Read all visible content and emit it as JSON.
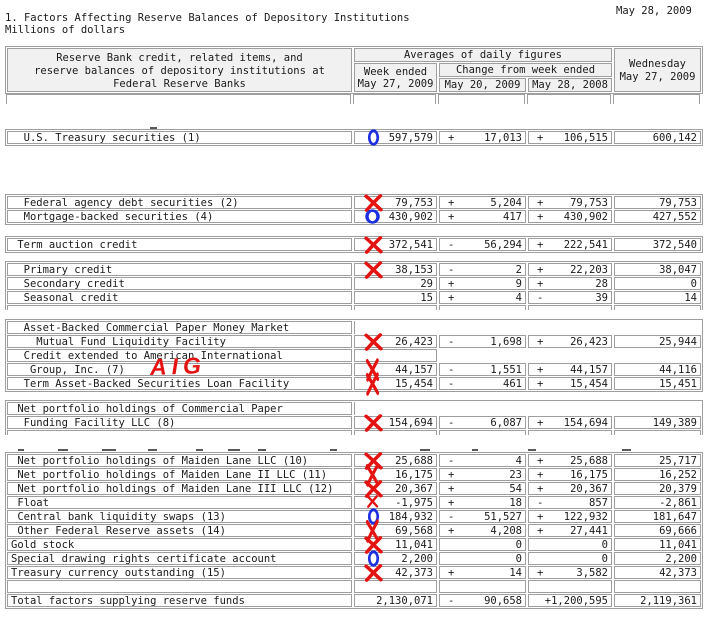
{
  "page": {
    "release_date": "May 28, 2009",
    "title": "1. Factors Affecting Reserve Balances of Depository Institutions",
    "subtitle": "Millions of dollars"
  },
  "colors": {
    "annotation_red": "#e51212",
    "annotation_blue": "#1b2ee0",
    "border_gray": "#9e9e9e"
  },
  "annotations": {
    "aig": "AIG"
  },
  "table": {
    "header": {
      "label_lines": [
        "Reserve Bank credit, related items, and",
        "reserve balances of depository institutions at",
        "Federal Reserve Banks"
      ],
      "averages": "Averages of daily figures",
      "week_ended_lines": [
        "Week ended",
        "May 27, 2009"
      ],
      "change_from": "Change from week ended",
      "change_col1": "May 20, 2009",
      "change_col2": "May 28, 2008",
      "wednesday_lines": [
        "Wednesday",
        "May 27, 2009"
      ]
    },
    "groups": [
      [
        {
          "t": "data",
          "label": "  U.S. Treasury securities (1)",
          "mark": "o",
          "week": "597,579",
          "c1s": "+",
          "c1v": "17,013",
          "c2s": "+",
          "c2v": "106,515",
          "wed": "600,142"
        }
      ],
      [
        {
          "t": "data",
          "label": "  Federal agency debt securities (2)",
          "mark": "x",
          "week": "79,753",
          "c1s": "+",
          "c1v": "5,204",
          "c2s": "+",
          "c2v": "79,753",
          "wed": "79,753"
        },
        {
          "t": "data",
          "label": "  Mortgage-backed securities (4)",
          "mark": "owide",
          "week": "430,902",
          "c1s": "+",
          "c1v": "417",
          "c2s": "+",
          "c2v": "430,902",
          "wed": "427,552"
        }
      ],
      [
        {
          "t": "data",
          "label": " Term auction credit",
          "mark": "x",
          "week": "372,541",
          "c1s": "-",
          "c1v": "56,294",
          "c2s": "+",
          "c2v": "222,541",
          "wed": "372,540"
        }
      ],
      [
        {
          "t": "data",
          "label": "  Primary credit",
          "mark": "x",
          "week": "38,153",
          "c1s": "-",
          "c1v": "2",
          "c2s": "+",
          "c2v": "22,203",
          "wed": "38,047"
        },
        {
          "t": "data",
          "label": "  Secondary credit",
          "mark": "",
          "week": "29",
          "c1s": "+",
          "c1v": "9",
          "c2s": "+",
          "c2v": "28",
          "wed": "0"
        },
        {
          "t": "data",
          "label": "  Seasonal credit",
          "mark": "",
          "week": "15",
          "c1s": "+",
          "c1v": "4",
          "c2s": "-",
          "c2v": "39",
          "wed": "14"
        },
        {
          "t": "partial"
        }
      ],
      [
        {
          "t": "label",
          "label": "  Asset-Backed Commercial Paper Money Market"
        },
        {
          "t": "data",
          "label": "    Mutual Fund Liquidity Facility",
          "mark": "x",
          "week": "26,423",
          "c1s": "-",
          "c1v": "1,698",
          "c2s": "+",
          "c2v": "26,423",
          "wed": "25,944"
        },
        {
          "t": "label2",
          "label": "  Credit extended to American International"
        },
        {
          "t": "data",
          "label": "   Group, Inc. (7)",
          "mark": "xtall",
          "week": "44,157",
          "c1s": "-",
          "c1v": "1,551",
          "c2s": "+",
          "c2v": "44,157",
          "wed": "44,116"
        },
        {
          "t": "data",
          "label": "  Term Asset-Backed Securities Loan Facility",
          "mark": "xtall",
          "week": "15,454",
          "c1s": "-",
          "c1v": "461",
          "c2s": "+",
          "c2v": "15,454",
          "wed": "15,451"
        }
      ],
      [
        {
          "t": "label",
          "label": " Net portfolio holdings of Commercial Paper"
        },
        {
          "t": "data",
          "label": "  Funding Facility LLC (8)",
          "mark": "x",
          "week": "154,694",
          "c1s": "-",
          "c1v": "6,087",
          "c2s": "+",
          "c2v": "154,694",
          "wed": "149,389"
        },
        {
          "t": "partial"
        }
      ],
      [
        {
          "t": "data",
          "label": " Net portfolio holdings of Maiden Lane LLC (10)",
          "mark": "x",
          "week": "25,688",
          "c1s": "-",
          "c1v": "4",
          "c2s": "+",
          "c2v": "25,688",
          "wed": "25,717"
        },
        {
          "t": "data",
          "label": " Net portfolio holdings of Maiden Lane II LLC (11)",
          "mark": "xtall",
          "week": "16,175",
          "c1s": "+",
          "c1v": "23",
          "c2s": "+",
          "c2v": "16,175",
          "wed": "16,252"
        },
        {
          "t": "data",
          "label": " Net portfolio holdings of Maiden Lane III LLC (12)",
          "mark": "x",
          "week": "20,367",
          "c1s": "+",
          "c1v": "54",
          "c2s": "+",
          "c2v": "20,367",
          "wed": "20,379"
        },
        {
          "t": "data",
          "label": " Float",
          "mark": "xsmall",
          "week": "-1,975",
          "c1s": "+",
          "c1v": "18",
          "c2s": "-",
          "c2v": "857",
          "wed": "-2,861"
        },
        {
          "t": "data",
          "label": " Central bank liquidity swaps (13)",
          "mark": "o",
          "week": "184,932",
          "c1s": "-",
          "c1v": "51,527",
          "c2s": "+",
          "c2v": "122,932",
          "wed": "181,647"
        },
        {
          "t": "data",
          "label": " Other Federal Reserve assets (14)",
          "mark": "xtall",
          "week": "69,568",
          "c1s": "+",
          "c1v": "4,208",
          "c2s": "+",
          "c2v": "27,441",
          "wed": "69,666"
        },
        {
          "t": "data",
          "label": "Gold stock",
          "mark": "x",
          "week": "11,041",
          "c1s": "",
          "c1v": "0",
          "c2s": "",
          "c2v": "0",
          "wed": "11,041"
        },
        {
          "t": "data",
          "label": "Special drawing rights certificate account",
          "mark": "o",
          "week": "2,200",
          "c1s": "",
          "c1v": "0",
          "c2s": "",
          "c2v": "0",
          "wed": "2,200"
        },
        {
          "t": "data",
          "label": "Treasury currency outstanding (15)",
          "mark": "x",
          "week": "42,373",
          "c1s": "+",
          "c1v": "14",
          "c2s": "+",
          "c2v": "3,582",
          "wed": "42,373"
        },
        {
          "t": "empty"
        },
        {
          "t": "data",
          "label": "Total factors supplying reserve funds",
          "mark": "",
          "week": "2,130,071",
          "c1s": "-",
          "c1v": "90,658",
          "c2s": "",
          "c2v": "+1,200,595",
          "wed": "2,119,361"
        }
      ]
    ]
  }
}
